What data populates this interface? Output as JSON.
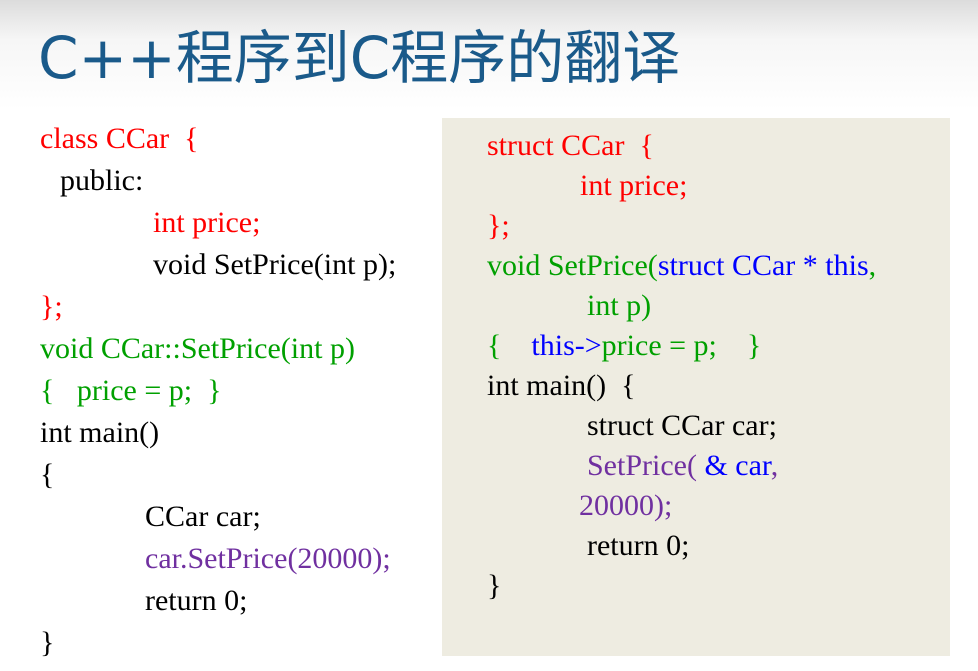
{
  "title": "C++程序到C程序的翻译",
  "left_code": {
    "l1": "class CCar  {",
    "l2": "public:",
    "l3": "int price;",
    "l4": "void SetPrice(int p);",
    "l5": "};",
    "l6": "void CCar::SetPrice(int p)",
    "l7": "{   price = p;  }",
    "l8": "int main()",
    "l9": "{",
    "l10": "CCar car;",
    "l11": "car.SetPrice(20000);",
    "l12": "return 0;",
    "l13": "}"
  },
  "right_code": {
    "l1": "struct CCar  {",
    "l2": "int price;",
    "l3": "};",
    "l4a": "void SetPrice(",
    "l4b": "struct CCar * this",
    "l4c": ",",
    "l5": "int p)",
    "l6a": "{    ",
    "l6b": "this->",
    "l6c": "price = p;    }",
    "l7": "int main()  {",
    "l8": "struct CCar car;",
    "l9a": "SetPrice( ",
    "l9b": "& car",
    "l9c": ",",
    "l10": "20000);",
    "l11": "return 0;",
    "l12": "}"
  },
  "colors": {
    "title": "#1a5a8a",
    "keyword_red": "#ff0000",
    "green": "#00a000",
    "purple": "#7030a0",
    "blue": "#0000ff",
    "panel_bg": "#eeece1"
  }
}
